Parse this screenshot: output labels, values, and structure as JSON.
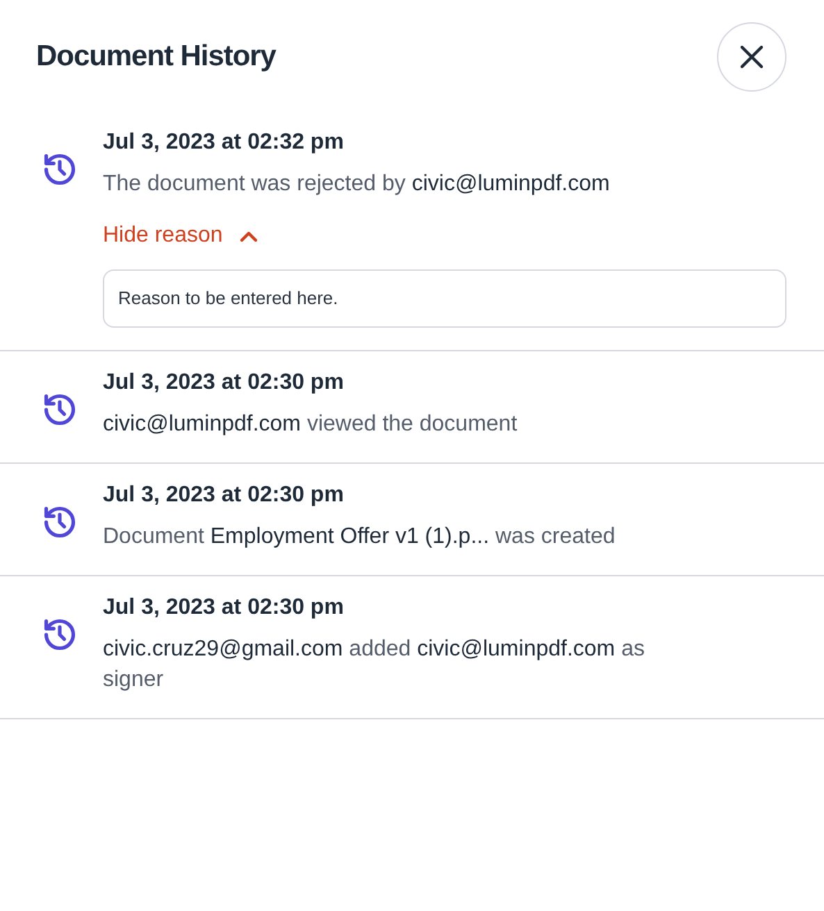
{
  "title": "Document History",
  "entries": [
    {
      "date": "Jul 3, 2023 at 02:32 pm",
      "message": [
        {
          "text": "The document was rejected by ",
          "emphasis": false
        },
        {
          "text": "civic@luminpdf.com",
          "emphasis": true
        }
      ],
      "reason": {
        "toggle_label": "Hide reason",
        "expanded": true,
        "text": "Reason to be entered here."
      }
    },
    {
      "date": "Jul 3, 2023 at 02:30 pm",
      "message": [
        {
          "text": "civic@luminpdf.com",
          "emphasis": true
        },
        {
          "text": " viewed the document",
          "emphasis": false
        }
      ]
    },
    {
      "date": "Jul 3, 2023 at 02:30 pm",
      "message": [
        {
          "text": "Document ",
          "emphasis": false
        },
        {
          "text": "Employment Offer v1 (1).p...",
          "emphasis": true
        },
        {
          "text": " was created",
          "emphasis": false
        }
      ]
    },
    {
      "date": "Jul 3, 2023 at 02:30 pm",
      "message": [
        {
          "text": "civic.cruz29@gmail.com",
          "emphasis": true
        },
        {
          "text": " added ",
          "emphasis": false
        },
        {
          "text": "civic@luminpdf.com",
          "emphasis": true
        },
        {
          "text": " as signer",
          "emphasis": false
        }
      ]
    }
  ]
}
